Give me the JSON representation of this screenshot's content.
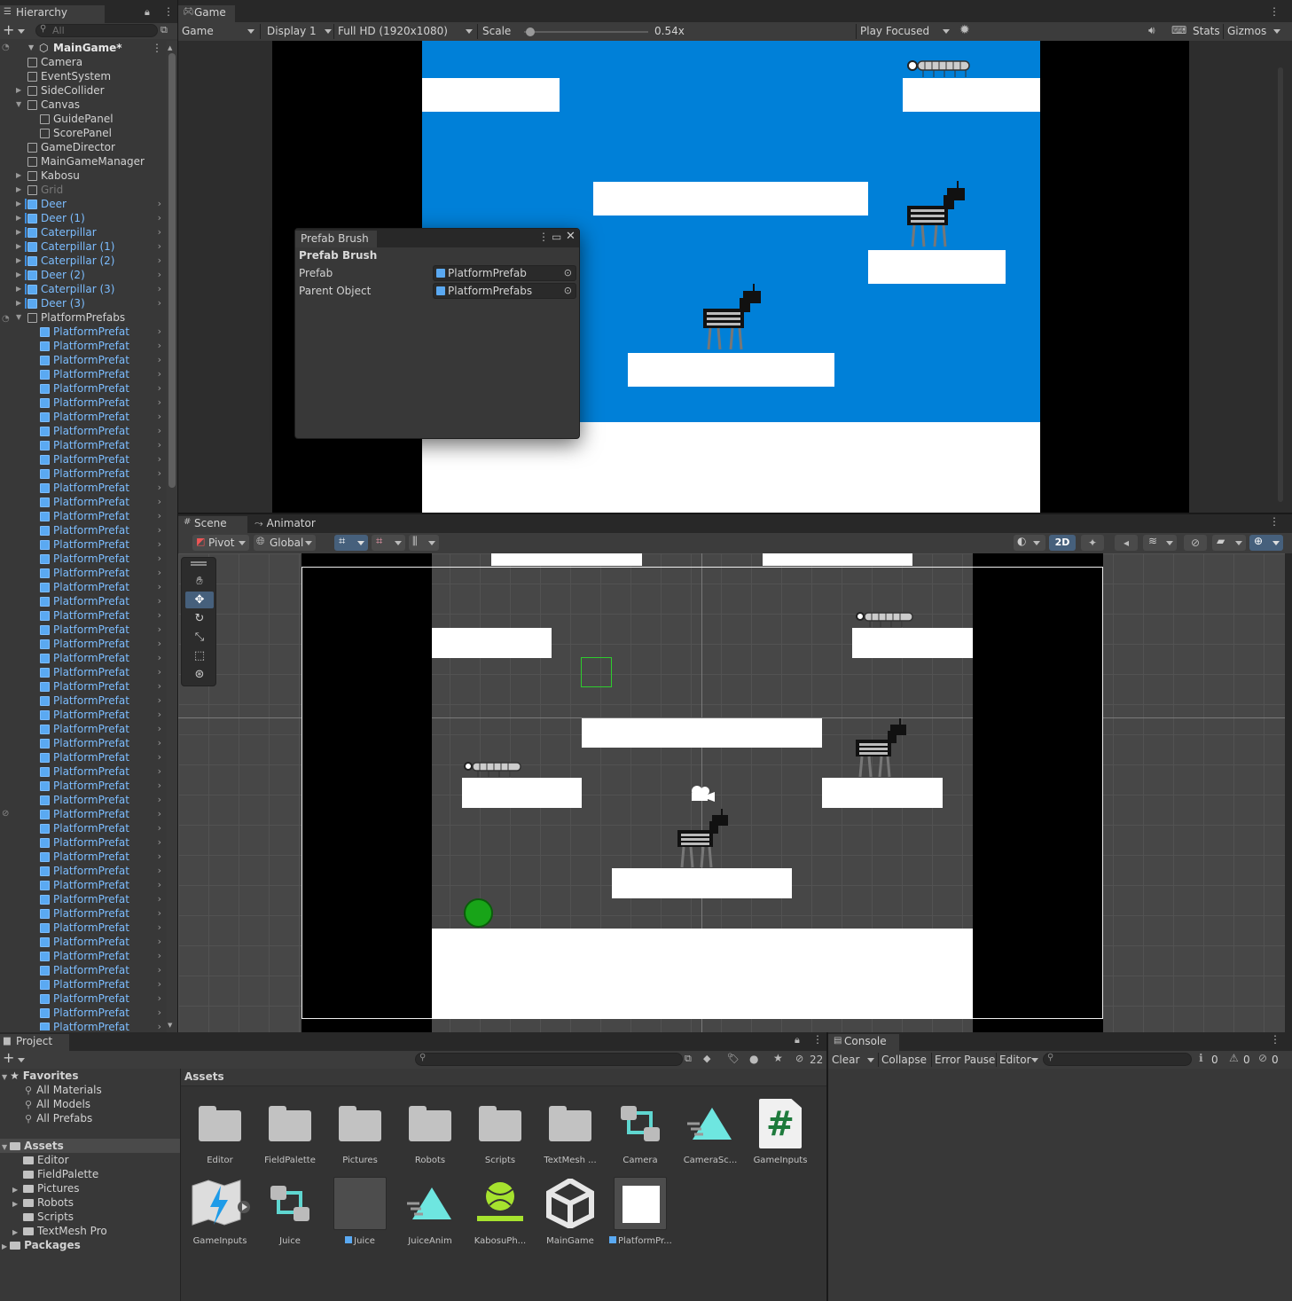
{
  "hierarchy": {
    "tab_label": "Hierarchy",
    "search_placeholder": "All",
    "root": "MainGame*",
    "items": [
      {
        "label": "Camera",
        "indent": 1,
        "arrow": false,
        "style": "normal",
        "chev": false
      },
      {
        "label": "EventSystem",
        "indent": 1,
        "arrow": false,
        "style": "normal",
        "chev": false
      },
      {
        "label": "SideCollider",
        "indent": 1,
        "arrow": "right",
        "style": "normal",
        "chev": false
      },
      {
        "label": "Canvas",
        "indent": 1,
        "arrow": "down",
        "style": "normal",
        "chev": false
      },
      {
        "label": "GuidePanel",
        "indent": 2,
        "arrow": false,
        "style": "normal",
        "chev": false
      },
      {
        "label": "ScorePanel",
        "indent": 2,
        "arrow": false,
        "style": "normal",
        "chev": false
      },
      {
        "label": "GameDirector",
        "indent": 1,
        "arrow": false,
        "style": "normal",
        "chev": false
      },
      {
        "label": "MainGameManager",
        "indent": 1,
        "arrow": false,
        "style": "normal",
        "chev": false
      },
      {
        "label": "Kabosu",
        "indent": 1,
        "arrow": "right",
        "style": "normal",
        "chev": false
      },
      {
        "label": "Grid",
        "indent": 1,
        "arrow": "right",
        "style": "grey",
        "chev": false
      },
      {
        "label": "Deer",
        "indent": 1,
        "arrow": "right",
        "style": "blue",
        "chev": true
      },
      {
        "label": "Deer (1)",
        "indent": 1,
        "arrow": "right",
        "style": "blue",
        "chev": true
      },
      {
        "label": "Caterpillar",
        "indent": 1,
        "arrow": "right",
        "style": "blue",
        "chev": true
      },
      {
        "label": "Caterpillar (1)",
        "indent": 1,
        "arrow": "right",
        "style": "blue",
        "chev": true
      },
      {
        "label": "Caterpillar (2)",
        "indent": 1,
        "arrow": "right",
        "style": "blue",
        "chev": true
      },
      {
        "label": "Deer (2)",
        "indent": 1,
        "arrow": "right",
        "style": "blue",
        "chev": true
      },
      {
        "label": "Caterpillar (3)",
        "indent": 1,
        "arrow": "right",
        "style": "blue",
        "chev": true
      },
      {
        "label": "Deer (3)",
        "indent": 1,
        "arrow": "right",
        "style": "blue",
        "chev": true
      },
      {
        "label": "PlatformPrefabs",
        "indent": 1,
        "arrow": "down",
        "style": "normal",
        "chev": false
      }
    ],
    "child_label": "PlatformPrefat",
    "child_count": 50
  },
  "game": {
    "tab_label": "Game",
    "view_dropdown": "Game",
    "display": "Display 1",
    "resolution": "Full HD (1920x1080)",
    "scale_label": "Scale",
    "scale_value": "0.54x",
    "scale_fraction": 0.05,
    "play_mode": "Play Focused",
    "stats": "Stats",
    "gizmos": "Gizmos",
    "sky_color": "#0080d8"
  },
  "prefab_brush": {
    "title": "Prefab Brush",
    "header": "Prefab Brush",
    "fields": [
      {
        "label": "Prefab",
        "value": "PlatformPrefab"
      },
      {
        "label": "Parent Object",
        "value": "PlatformPrefabs"
      }
    ]
  },
  "scene": {
    "tab_scene": "Scene",
    "tab_animator": "Animator",
    "pivot": "Pivot",
    "global": "Global",
    "mode_2d": "2D"
  },
  "project": {
    "tab_label": "Project",
    "hidden_count": "22",
    "favorites": {
      "label": "Favorites",
      "items": [
        "All Materials",
        "All Models",
        "All Prefabs"
      ]
    },
    "assets_root": "Assets",
    "asset_folders": [
      {
        "label": "Editor",
        "arrow": false
      },
      {
        "label": "FieldPalette",
        "arrow": false
      },
      {
        "label": "Pictures",
        "arrow": true
      },
      {
        "label": "Robots",
        "arrow": true
      },
      {
        "label": "Scripts",
        "arrow": false
      },
      {
        "label": "TextMesh Pro",
        "arrow": true
      }
    ],
    "packages": "Packages",
    "breadcrumb": "Assets",
    "grid": [
      {
        "label": "Editor",
        "icon": "folder-icon"
      },
      {
        "label": "FieldPalette",
        "icon": "folder-icon"
      },
      {
        "label": "Pictures",
        "icon": "folder-icon"
      },
      {
        "label": "Robots",
        "icon": "folder-icon"
      },
      {
        "label": "Scripts",
        "icon": "folder-icon"
      },
      {
        "label": "TextMesh ...",
        "icon": "folder-icon"
      },
      {
        "label": "Camera",
        "icon": "blend-tree-icon"
      },
      {
        "label": "CameraSc...",
        "icon": "animation-icon"
      },
      {
        "label": "GameInputs",
        "icon": "csharp-script-icon"
      },
      {
        "label": "GameInputs",
        "icon": "input-actions-icon"
      },
      {
        "label": "Juice",
        "icon": "blend-tree-icon"
      },
      {
        "label": "Juice",
        "icon": "prefab-preview-icon"
      },
      {
        "label": "JuiceAnim",
        "icon": "animation-icon"
      },
      {
        "label": "KabosuPh...",
        "icon": "physics-material-icon"
      },
      {
        "label": "MainGame",
        "icon": "unity-scene-icon"
      },
      {
        "label": "PlatformPr...",
        "icon": "platform-prefab-icon"
      }
    ]
  },
  "console": {
    "tab_label": "Console",
    "clear": "Clear",
    "collapse": "Collapse",
    "error_pause": "Error Pause",
    "editor": "Editor",
    "counts": {
      "log": "0",
      "warn": "0",
      "error": "0"
    }
  }
}
